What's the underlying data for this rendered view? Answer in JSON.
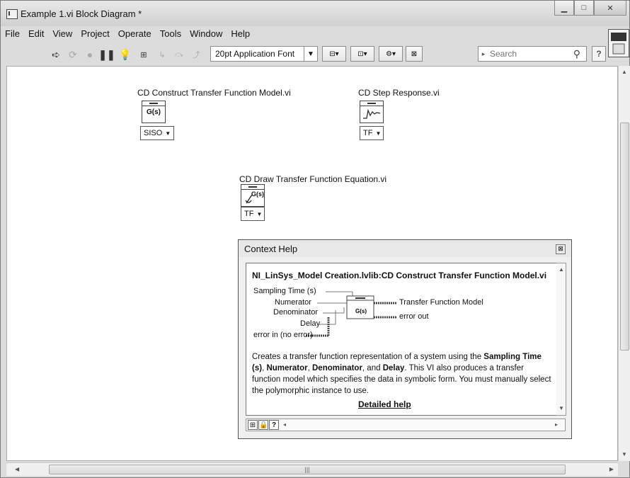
{
  "window": {
    "title": "Example 1.vi Block Diagram *"
  },
  "menu": [
    "File",
    "Edit",
    "View",
    "Project",
    "Operate",
    "Tools",
    "Window",
    "Help"
  ],
  "toolbar": {
    "font_label": "20pt Application Font",
    "search_placeholder": "Search"
  },
  "diagram": {
    "nodes": [
      {
        "label": "CD Construct Transfer Function Model.vi",
        "icon": "transfer-function-icon",
        "glyph": "G(s)",
        "selector": "SISO"
      },
      {
        "label": "CD Step Response.vi",
        "icon": "step-response-icon",
        "glyph": "",
        "selector": "TF"
      },
      {
        "label": "CD Draw Transfer Function Equation.vi",
        "icon": "draw-equation-icon",
        "glyph": "G(s)",
        "selector": "TF"
      }
    ]
  },
  "context_help": {
    "title": "Context Help",
    "vi_name": "NI_LinSys_Model Creation.lvlib:CD Construct Transfer Function Model.vi",
    "inputs": [
      "Sampling Time (s)",
      "Numerator",
      "Denominator",
      "Delay",
      "error in (no error)"
    ],
    "outputs": [
      "Transfer Function Model",
      "error out"
    ],
    "description": {
      "p1": "Creates a transfer function representation of a system using the ",
      "b1": "Sampling Time (s)",
      "p2": ", ",
      "b2": "Numerator",
      "p3": ", ",
      "b3": "Denominator",
      "p4": ", and ",
      "b4": "Delay",
      "p5": ". This VI also produces a transfer function model which specifies the data in symbolic form. You must manually select the polymorphic instance to use."
    },
    "detailed_help": "Detailed help",
    "icon_glyph": "G(s)"
  },
  "colors": {
    "canvas": "#ffffff",
    "chrome": "#dcdcdc"
  }
}
